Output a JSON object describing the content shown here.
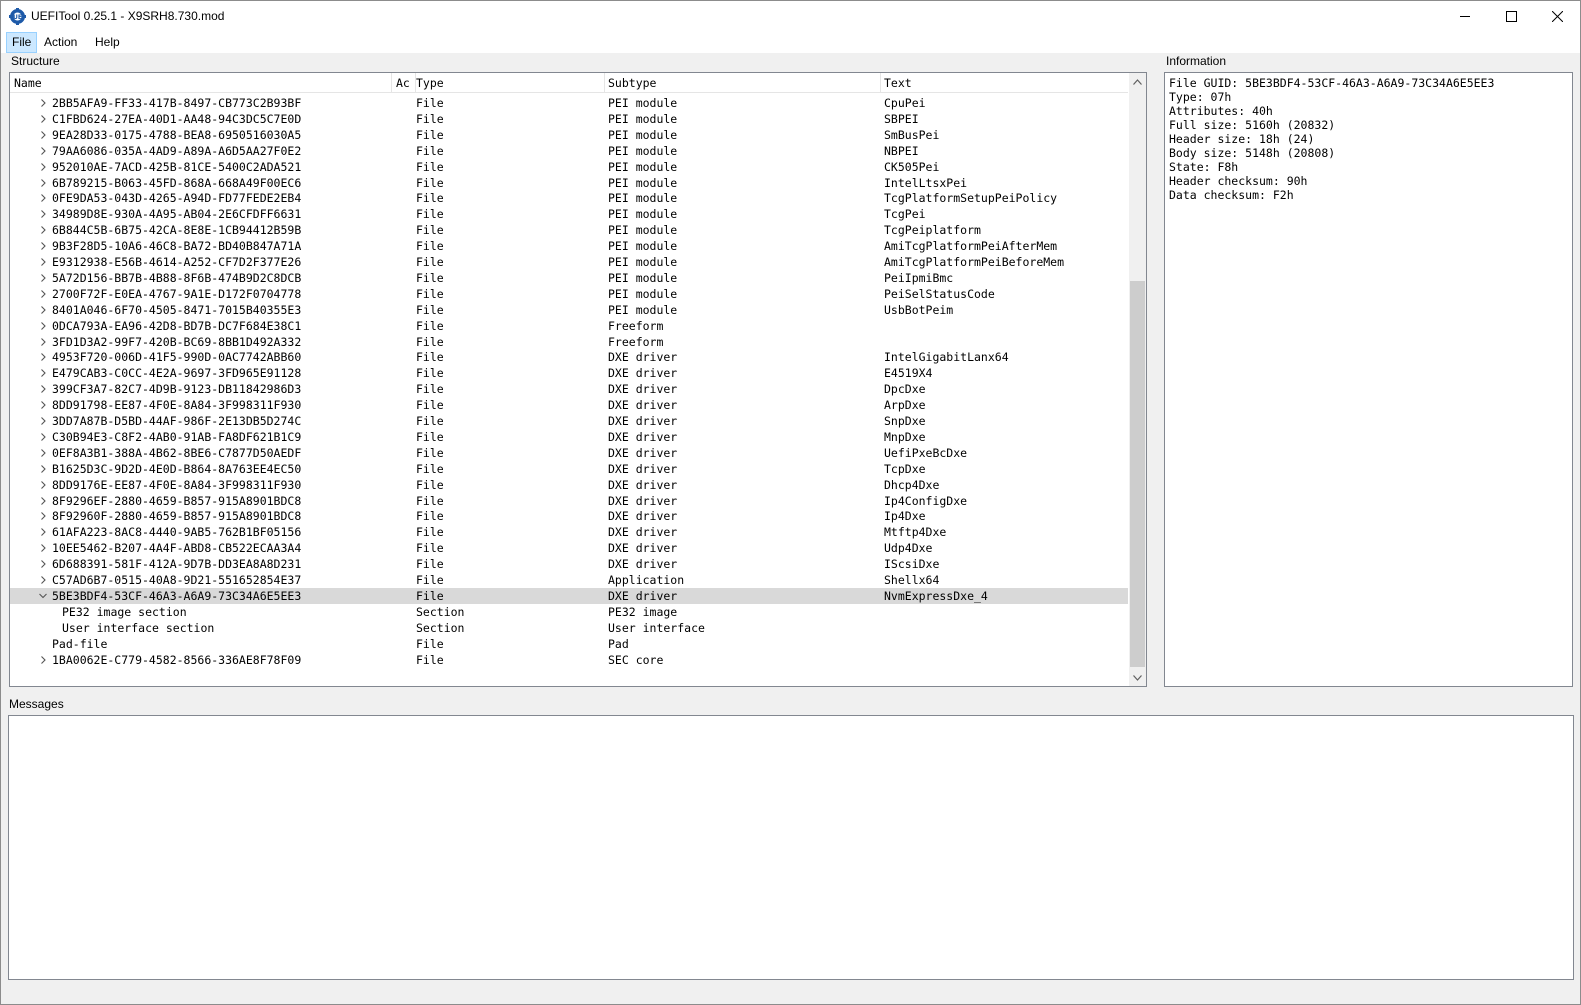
{
  "window": {
    "title": "UEFITool 0.25.1 - X9SRH8.730.mod"
  },
  "menu": {
    "file": "File",
    "action": "Action",
    "help": "Help"
  },
  "panels": {
    "structure": "Structure",
    "information": "Information",
    "messages": "Messages"
  },
  "columns": {
    "name": "Name",
    "action": "Ac",
    "type": "Type",
    "subtype": "Subtype",
    "text": "Text"
  },
  "rows": [
    {
      "name": "2BB5AFA9-FF33-417B-8497-CB773C2B93BF",
      "type": "File",
      "subtype": "PEI module",
      "text": "CpuPei",
      "chevron": "right",
      "indent": 0
    },
    {
      "name": "C1FBD624-27EA-40D1-AA48-94C3DC5C7E0D",
      "type": "File",
      "subtype": "PEI module",
      "text": "SBPEI",
      "chevron": "right",
      "indent": 0
    },
    {
      "name": "9EA28D33-0175-4788-BEA8-6950516030A5",
      "type": "File",
      "subtype": "PEI module",
      "text": "SmBusPei",
      "chevron": "right",
      "indent": 0
    },
    {
      "name": "79AA6086-035A-4AD9-A89A-A6D5AA27F0E2",
      "type": "File",
      "subtype": "PEI module",
      "text": "NBPEI",
      "chevron": "right",
      "indent": 0
    },
    {
      "name": "952010AE-7ACD-425B-81CE-5400C2ADA521",
      "type": "File",
      "subtype": "PEI module",
      "text": "CK505Pei",
      "chevron": "right",
      "indent": 0
    },
    {
      "name": "6B789215-B063-45FD-868A-668A49F00EC6",
      "type": "File",
      "subtype": "PEI module",
      "text": "IntelLtsxPei",
      "chevron": "right",
      "indent": 0
    },
    {
      "name": "0FE9DA53-043D-4265-A94D-FD77FEDE2EB4",
      "type": "File",
      "subtype": "PEI module",
      "text": "TcgPlatformSetupPeiPolicy",
      "chevron": "right",
      "indent": 0
    },
    {
      "name": "34989D8E-930A-4A95-AB04-2E6CFDFF6631",
      "type": "File",
      "subtype": "PEI module",
      "text": "TcgPei",
      "chevron": "right",
      "indent": 0
    },
    {
      "name": "6B844C5B-6B75-42CA-8E8E-1CB94412B59B",
      "type": "File",
      "subtype": "PEI module",
      "text": "TcgPeiplatform",
      "chevron": "right",
      "indent": 0
    },
    {
      "name": "9B3F28D5-10A6-46C8-BA72-BD40B847A71A",
      "type": "File",
      "subtype": "PEI module",
      "text": "AmiTcgPlatformPeiAfterMem",
      "chevron": "right",
      "indent": 0
    },
    {
      "name": "E9312938-E56B-4614-A252-CF7D2F377E26",
      "type": "File",
      "subtype": "PEI module",
      "text": "AmiTcgPlatformPeiBeforeMem",
      "chevron": "right",
      "indent": 0
    },
    {
      "name": "5A72D156-BB7B-4B88-8F6B-474B9D2C8DCB",
      "type": "File",
      "subtype": "PEI module",
      "text": "PeiIpmiBmc",
      "chevron": "right",
      "indent": 0
    },
    {
      "name": "2700F72F-E0EA-4767-9A1E-D172F0704778",
      "type": "File",
      "subtype": "PEI module",
      "text": "PeiSelStatusCode",
      "chevron": "right",
      "indent": 0
    },
    {
      "name": "8401A046-6F70-4505-8471-7015B40355E3",
      "type": "File",
      "subtype": "PEI module",
      "text": "UsbBotPeim",
      "chevron": "right",
      "indent": 0
    },
    {
      "name": "0DCA793A-EA96-42D8-BD7B-DC7F684E38C1",
      "type": "File",
      "subtype": "Freeform",
      "text": "",
      "chevron": "right",
      "indent": 0
    },
    {
      "name": "3FD1D3A2-99F7-420B-BC69-8BB1D492A332",
      "type": "File",
      "subtype": "Freeform",
      "text": "",
      "chevron": "right",
      "indent": 0
    },
    {
      "name": "4953F720-006D-41F5-990D-0AC7742ABB60",
      "type": "File",
      "subtype": "DXE driver",
      "text": "IntelGigabitLanx64",
      "chevron": "right",
      "indent": 0
    },
    {
      "name": "E479CAB3-C0CC-4E2A-9697-3FD965E91128",
      "type": "File",
      "subtype": "DXE driver",
      "text": "E4519X4",
      "chevron": "right",
      "indent": 0
    },
    {
      "name": "399CF3A7-82C7-4D9B-9123-DB11842986D3",
      "type": "File",
      "subtype": "DXE driver",
      "text": "DpcDxe",
      "chevron": "right",
      "indent": 0
    },
    {
      "name": "8DD91798-EE87-4F0E-8A84-3F998311F930",
      "type": "File",
      "subtype": "DXE driver",
      "text": "ArpDxe",
      "chevron": "right",
      "indent": 0
    },
    {
      "name": "3DD7A87B-D5BD-44AF-986F-2E13DB5D274C",
      "type": "File",
      "subtype": "DXE driver",
      "text": "SnpDxe",
      "chevron": "right",
      "indent": 0
    },
    {
      "name": "C30B94E3-C8F2-4AB0-91AB-FA8DF621B1C9",
      "type": "File",
      "subtype": "DXE driver",
      "text": "MnpDxe",
      "chevron": "right",
      "indent": 0
    },
    {
      "name": "0EF8A3B1-388A-4B62-8BE6-C7877D50AEDF",
      "type": "File",
      "subtype": "DXE driver",
      "text": "UefiPxeBcDxe",
      "chevron": "right",
      "indent": 0
    },
    {
      "name": "B1625D3C-9D2D-4E0D-B864-8A763EE4EC50",
      "type": "File",
      "subtype": "DXE driver",
      "text": "TcpDxe",
      "chevron": "right",
      "indent": 0
    },
    {
      "name": "8DD9176E-EE87-4F0E-8A84-3F998311F930",
      "type": "File",
      "subtype": "DXE driver",
      "text": "Dhcp4Dxe",
      "chevron": "right",
      "indent": 0
    },
    {
      "name": "8F9296EF-2880-4659-B857-915A8901BDC8",
      "type": "File",
      "subtype": "DXE driver",
      "text": "Ip4ConfigDxe",
      "chevron": "right",
      "indent": 0
    },
    {
      "name": "8F92960F-2880-4659-B857-915A8901BDC8",
      "type": "File",
      "subtype": "DXE driver",
      "text": "Ip4Dxe",
      "chevron": "right",
      "indent": 0
    },
    {
      "name": "61AFA223-8AC8-4440-9AB5-762B1BF05156",
      "type": "File",
      "subtype": "DXE driver",
      "text": "Mtftp4Dxe",
      "chevron": "right",
      "indent": 0
    },
    {
      "name": "10EE5462-B207-4A4F-ABD8-CB522ECAA3A4",
      "type": "File",
      "subtype": "DXE driver",
      "text": "Udp4Dxe",
      "chevron": "right",
      "indent": 0
    },
    {
      "name": "6D688391-581F-412A-9D7B-DD3EA8A8D231",
      "type": "File",
      "subtype": "DXE driver",
      "text": "IScsiDxe",
      "chevron": "right",
      "indent": 0
    },
    {
      "name": "C57AD6B7-0515-40A8-9D21-551652854E37",
      "type": "File",
      "subtype": "Application",
      "text": "Shellx64",
      "chevron": "right",
      "indent": 0
    },
    {
      "name": "5BE3BDF4-53CF-46A3-A6A9-73C34A6E5EE3",
      "type": "File",
      "subtype": "DXE driver",
      "text": "NvmExpressDxe_4",
      "chevron": "down",
      "indent": 0,
      "selected": true
    },
    {
      "name": "PE32 image section",
      "type": "Section",
      "subtype": "PE32 image",
      "text": "",
      "chevron": "none",
      "indent": 1
    },
    {
      "name": "User interface section",
      "type": "Section",
      "subtype": "User interface",
      "text": "",
      "chevron": "none",
      "indent": 1
    },
    {
      "name": "Pad-file",
      "type": "File",
      "subtype": "Pad",
      "text": "",
      "chevron": "none",
      "indent": 0
    },
    {
      "name": "1BA0062E-C779-4582-8566-336AE8F78F09",
      "type": "File",
      "subtype": "SEC core",
      "text": "",
      "chevron": "right",
      "indent": 0
    }
  ],
  "information": [
    "File GUID: 5BE3BDF4-53CF-46A3-A6A9-73C34A6E5EE3",
    "Type: 07h",
    "Attributes: 40h",
    "Full size: 5160h (20832)",
    "Header size: 18h (24)",
    "Body size: 5148h (20808)",
    "State: F8h",
    "Header checksum: 90h",
    "Data checksum: F2h"
  ],
  "colors": {
    "selected_row": "#d9d9d9",
    "menu_highlight": "#cce8ff",
    "icon_blue": "#1e5aa8"
  }
}
